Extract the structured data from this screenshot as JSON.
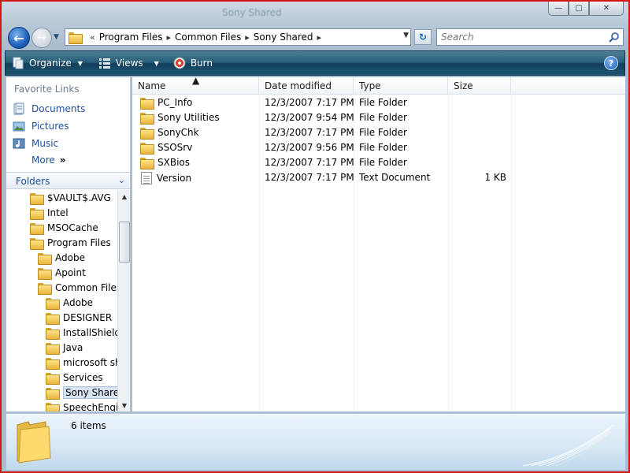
{
  "window": {
    "title": "Sony Shared",
    "caption": {
      "minimize": "—",
      "maximize": "▢",
      "close": "✕"
    }
  },
  "address": {
    "overflow": "«",
    "crumbs": [
      "Program Files",
      "Common Files",
      "Sony Shared"
    ],
    "separator": "▸"
  },
  "search": {
    "placeholder": "Search"
  },
  "toolbar": {
    "organize": "Organize",
    "views": "Views",
    "burn": "Burn",
    "help": "?"
  },
  "favorites": {
    "header": "Favorite Links",
    "items": [
      "Documents",
      "Pictures",
      "Music"
    ],
    "more": "More",
    "more_arrow": "»"
  },
  "folders": {
    "header": "Folders",
    "chevron": "⌄",
    "tree": [
      {
        "label": "$VAULT$.AVG",
        "level": 0
      },
      {
        "label": "Intel",
        "level": 0
      },
      {
        "label": "MSOCache",
        "level": 0
      },
      {
        "label": "Program Files",
        "level": 0
      },
      {
        "label": "Adobe",
        "level": 1
      },
      {
        "label": "Apoint",
        "level": 1
      },
      {
        "label": "Common Files",
        "level": 1
      },
      {
        "label": "Adobe",
        "level": 2
      },
      {
        "label": "DESIGNER",
        "level": 2
      },
      {
        "label": "InstallShield",
        "level": 2
      },
      {
        "label": "Java",
        "level": 2
      },
      {
        "label": "microsoft sha",
        "level": 2
      },
      {
        "label": "Services",
        "level": 2
      },
      {
        "label": "Sony Shared",
        "level": 2,
        "selected": true
      },
      {
        "label": "SpeechEngin",
        "level": 2
      }
    ]
  },
  "columns": {
    "name": "Name",
    "date": "Date modified",
    "type": "Type",
    "size": "Size"
  },
  "files": [
    {
      "name": "PC_Info",
      "date": "12/3/2007 7:17 PM",
      "type": "File Folder",
      "size": "",
      "icon": "folder"
    },
    {
      "name": "Sony Utilities",
      "date": "12/3/2007 9:54 PM",
      "type": "File Folder",
      "size": "",
      "icon": "folder"
    },
    {
      "name": "SonyChk",
      "date": "12/3/2007 7:17 PM",
      "type": "File Folder",
      "size": "",
      "icon": "folder"
    },
    {
      "name": "SSOSrv",
      "date": "12/3/2007 9:56 PM",
      "type": "File Folder",
      "size": "",
      "icon": "folder"
    },
    {
      "name": "SXBios",
      "date": "12/3/2007 7:17 PM",
      "type": "File Folder",
      "size": "",
      "icon": "folder"
    },
    {
      "name": "Version",
      "date": "12/3/2007 7:17 PM",
      "type": "Text Document",
      "size": "1 KB",
      "icon": "text-document"
    }
  ],
  "details": {
    "count": "6 items"
  },
  "colors": {
    "frame": "#d41313",
    "toolbar": "#255c78",
    "link": "#1c4f9c"
  }
}
